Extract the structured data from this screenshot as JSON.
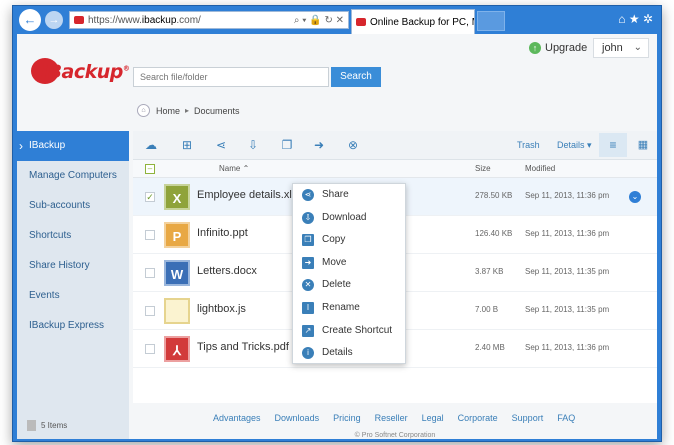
{
  "browser": {
    "url_prefix": "https://www.",
    "url_host": "ibackup",
    "url_suffix": ".com/",
    "url_tools": "⌕ ▾ 🔒 ↻ ✕",
    "tab_title": "Online Backup for PC, Mac ...",
    "tab_close": "×",
    "window_tools": "⌂ ★ ✲"
  },
  "header": {
    "logo_text": "IBackup",
    "logo_mark": "®",
    "search_placeholder": "Search file/folder",
    "search_button": "Search",
    "upgrade_label": "Upgrade",
    "user_name": "john",
    "user_chevron": "⌄"
  },
  "breadcrumb": {
    "home": "Home",
    "separator": "▸",
    "current": "Documents"
  },
  "sidebar": {
    "items": [
      {
        "label": "IBackup",
        "active": true
      },
      {
        "label": "Manage Computers"
      },
      {
        "label": "Sub-accounts"
      },
      {
        "label": "Shortcuts"
      },
      {
        "label": "Share History"
      },
      {
        "label": "Events"
      },
      {
        "label": "IBackup Express"
      }
    ],
    "footer_count": "5 Items"
  },
  "toolbar": {
    "trash_label": "Trash",
    "details_label": "Details ▾"
  },
  "columns": {
    "name": "Name ⌃",
    "size": "Size",
    "modified": "Modified"
  },
  "files": [
    {
      "name": "Employee details.xls",
      "size": "278.50 KB",
      "modified": "Sep 11, 2013, 11:36 pm",
      "icon": "xls-icon",
      "icon_letter": "X",
      "checked": "✓",
      "selected": true
    },
    {
      "name": "Infinito.ppt",
      "size": "126.40 KB",
      "modified": "Sep 11, 2013, 11:36 pm",
      "icon": "ppt-icon",
      "icon_letter": "P",
      "checked": ""
    },
    {
      "name": "Letters.docx",
      "size": "3.87 KB",
      "modified": "Sep 11, 2013, 11:35 pm",
      "icon": "doc-icon",
      "icon_letter": "W",
      "checked": ""
    },
    {
      "name": "lightbox.js",
      "size": "7.00 B",
      "modified": "Sep 11, 2013, 11:35 pm",
      "icon": "js-icon",
      "icon_letter": "",
      "checked": ""
    },
    {
      "name": "Tips and Tricks.pdf",
      "size": "2.40 MB",
      "modified": "Sep 11, 2013, 11:36 pm",
      "icon": "pdf-icon",
      "icon_letter": "⅄",
      "checked": ""
    }
  ],
  "context_menu": {
    "items": [
      {
        "label": "Share",
        "icon": "share-icon"
      },
      {
        "label": "Download",
        "icon": "download-icon"
      },
      {
        "label": "Copy",
        "icon": "copy-icon"
      },
      {
        "label": "Move",
        "icon": "move-icon"
      },
      {
        "label": "Delete",
        "icon": "delete-icon"
      },
      {
        "label": "Rename",
        "icon": "rename-icon"
      },
      {
        "label": "Create Shortcut",
        "icon": "shortcut-icon"
      },
      {
        "label": "Details",
        "icon": "info-icon"
      }
    ]
  },
  "footer": {
    "links": [
      "Advantages",
      "Downloads",
      "Pricing",
      "Reseller",
      "Legal",
      "Corporate",
      "Support",
      "FAQ"
    ],
    "copyright": "© Pro Softnet Corporation"
  },
  "colors": {
    "accent": "#2f7fd6",
    "brand": "#d6262d",
    "sidebar_bg": "#dfe7ef"
  }
}
